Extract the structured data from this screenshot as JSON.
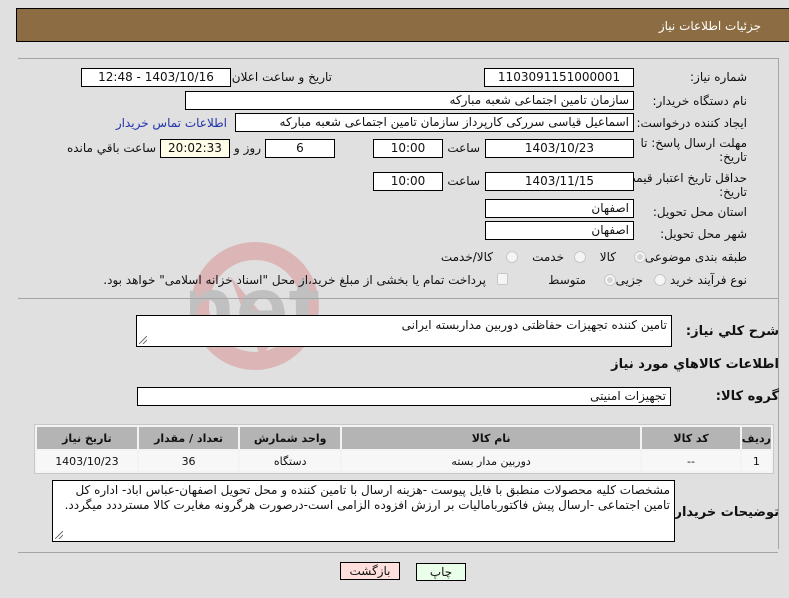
{
  "header": {
    "title": "جزئیات اطلاعات نیاز"
  },
  "fields": {
    "need_number": {
      "label": "شماره نیاز:",
      "value": "1103091151000001"
    },
    "announce_datetime": {
      "label": "تاریخ و ساعت اعلان عمومی:",
      "value": "1403/10/16 - 12:48"
    },
    "buyer_org": {
      "label": "نام دستگاه خریدار:",
      "value": "سازمان تامین اجتماعی شعبه مبارکه"
    },
    "requester": {
      "label": "ایجاد کننده درخواست:",
      "value": "اسماعیل قیاسی سررکی کارپرداز سازمان تامین اجتماعی شعبه مبارکه",
      "contact_link": "اطلاعات تماس خریدار"
    },
    "reply_deadline": {
      "label_line1": "مهلت ارسال پاسخ: تا",
      "label_line2": "تاریخ:",
      "date": "1403/10/23",
      "time_label": "ساعت",
      "time": "10:00",
      "days": "6",
      "days_label": "روز و",
      "remaining": "20:02:33",
      "remaining_label": "ساعت باقي مانده"
    },
    "price_validity": {
      "label_line1": "حداقل تاریخ اعتبار قیمت: تا",
      "label_line2": "تاریخ:",
      "date": "1403/11/15",
      "time_label": "ساعت",
      "time": "10:00"
    },
    "delivery_province": {
      "label": "استان محل تحویل:",
      "value": "اصفهان"
    },
    "delivery_city": {
      "label": "شهر محل تحویل:",
      "value": "اصفهان"
    },
    "category": {
      "label": "طبقه بندی موضوعی:",
      "options": [
        "کالا",
        "خدمت",
        "کالا/خدمت"
      ],
      "selected": "کالا"
    },
    "purchase_type": {
      "label": "نوع فرآیند خرید :",
      "options": [
        "جزیی",
        "متوسط"
      ],
      "selected": "متوسط",
      "treasury_note": "پرداخت تمام یا بخشی از مبلغ خرید،از محل \"اسناد خزانه اسلامی\" خواهد بود.",
      "treasury_checked": false
    }
  },
  "description": {
    "label": "شرح کلي نياز:",
    "value": "تامین کننده  تجهیزات حفاظتی دوربین مداربسته ایرانی"
  },
  "goods_section": {
    "title": "اطلاعات کالاهاي مورد نياز",
    "group_label": "گروه کالا:",
    "group_value": "تجهیزات امنیتی"
  },
  "table": {
    "headers": [
      "ردیف",
      "کد کالا",
      "نام کالا",
      "واحد شمارش",
      "تعداد / مقدار",
      "تاریخ نیاز"
    ],
    "rows": [
      {
        "index": "1",
        "code": "--",
        "name": "دوربین مدار بسته",
        "unit": "دستگاه",
        "qty": "36",
        "date": "1403/10/23"
      }
    ]
  },
  "buyer_notes": {
    "label": "توضیحات خریدار:",
    "value": "مشخصات کلیه محصولات منطبق با فایل پیوست -هزینه ارسال با تامین کننده  و محل تحویل اصفهان-عباس اباد- اداره کل تامین اجتماعی -ارسال پیش فاکتوربامالیات بر ارزش افزوده الزامی است-درصورت هرگرونه مغایرت کالا مسترددد میگردد."
  },
  "buttons": {
    "print": "چاپ",
    "back": "بازگشت"
  },
  "colors": {
    "header_bg": "#8c6d43",
    "link": "#2233aa",
    "print_bg": "#eaffea",
    "back_bg": "#ffdede"
  },
  "watermark": "AriaTender.net"
}
